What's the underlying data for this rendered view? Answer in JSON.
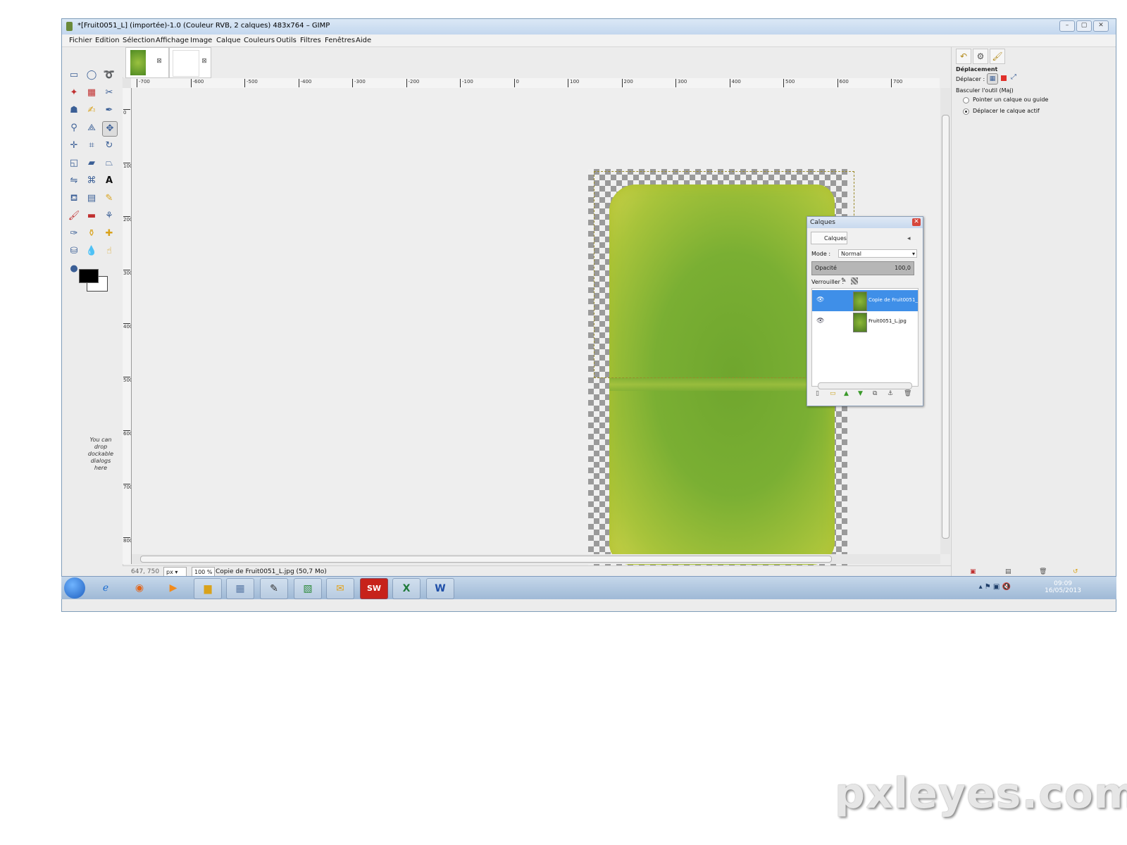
{
  "window": {
    "title": "*[Fruit0051_L] (importée)-1.0 (Couleur RVB, 2 calques) 483x764 – GIMP"
  },
  "menubar": {
    "items": [
      "Fichier",
      "Edition",
      "Sélection",
      "Affichage",
      "Image",
      "Calque",
      "Couleurs",
      "Outils",
      "Filtres",
      "Fenêtres",
      "Aide"
    ]
  },
  "toolbox": {
    "drop_hint": "You can drop dockable dialogs here",
    "foreground_color": "#000000",
    "background_color": "#ffffff"
  },
  "ruler": {
    "h_labels": [
      "-700",
      "-600",
      "-500",
      "-400",
      "-300",
      "-200",
      "-100",
      "0",
      "100",
      "200",
      "300",
      "400",
      "500",
      "600",
      "700"
    ],
    "v_labels": [
      "0",
      "100",
      "200",
      "300",
      "400",
      "500",
      "600",
      "700",
      "800"
    ]
  },
  "statusbar": {
    "coords": "647, 750",
    "unit": "px",
    "zoom": "100 %",
    "message": "Copie de Fruit0051_L.jpg (50,7 Mo)"
  },
  "tool_options": {
    "title": "Déplacement",
    "move_label": "Déplacer :",
    "toggle_label": "Basculer l'outil  (Maj)",
    "option1": "Pointer un calque ou guide",
    "option2": "Déplacer le calque actif",
    "selected_option": 2
  },
  "layers_dialog": {
    "title": "Calques",
    "tab_label": "Calques",
    "mode_label": "Mode :",
    "mode_value": "Normal",
    "opacity_label": "Opacité",
    "opacity_value": "100,0",
    "lock_label": "Verrouiller :",
    "layers": [
      {
        "name": "Copie de Fruit0051_",
        "selected": true,
        "visible": true
      },
      {
        "name": "Fruit0051_L.jpg",
        "selected": false,
        "visible": true
      }
    ]
  },
  "taskbar": {
    "time": "09:09",
    "date": "16/05/2013"
  },
  "watermark": "pxleyes.com"
}
